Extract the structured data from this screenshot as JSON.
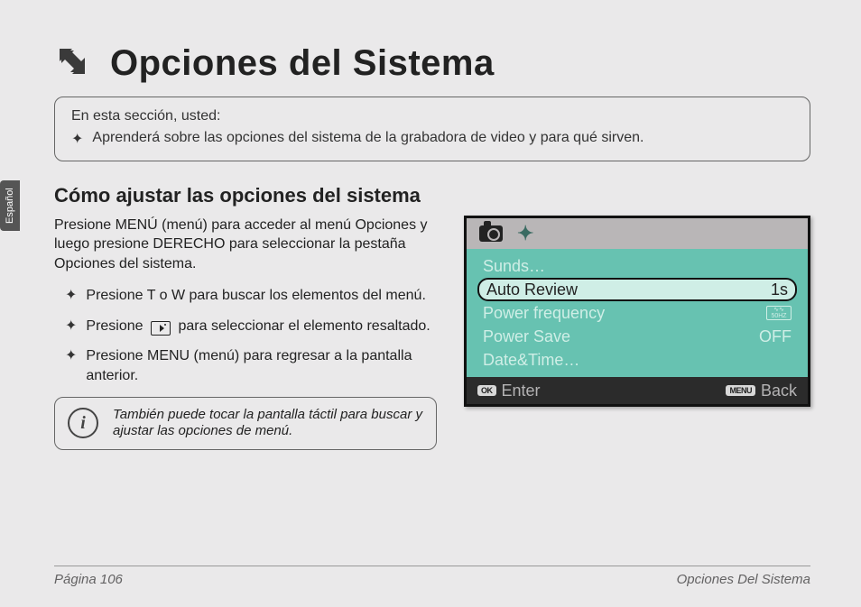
{
  "lang_tab": "Español",
  "title": "Opciones del Sistema",
  "intro": {
    "lead": "En esta sección, usted:",
    "item": "Aprenderá sobre las opciones del sistema de la grabadora de video y para qué sirven."
  },
  "subhead": "Cómo ajustar las opciones del sistema",
  "para": "Presione MENÚ (menú) para acceder al menú Opciones y luego presione DERECHO para seleccionar la pestaña Opciones del sistema.",
  "bullets": {
    "b1": "Presione T o W para buscar los elementos del menú.",
    "b2a": "Presione",
    "b2b": "para seleccionar el elemento resaltado.",
    "b3": "Presione MENU (menú) para regresar a la pantalla anterior."
  },
  "tip": "También puede tocar la pantalla táctil para buscar y ajustar las opciones de menú.",
  "device": {
    "rows": {
      "r1": "Sunds…",
      "r2_label": "Auto Review",
      "r2_value": "1s",
      "r3_label": "Power frequency",
      "r3_value": "50HZ",
      "r4_label": "Power Save",
      "r4_value": "OFF",
      "r5": "Date&Time…"
    },
    "footer": {
      "ok_pill": "OK",
      "enter": "Enter",
      "menu_pill": "MENU",
      "back": "Back"
    }
  },
  "footer": {
    "left": "Página 106",
    "right": "Opciones Del Sistema"
  }
}
